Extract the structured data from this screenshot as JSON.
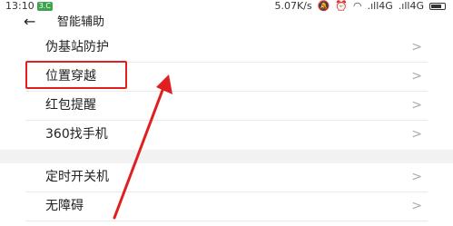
{
  "status_bar": {
    "time": "13:10",
    "badge": "3.C",
    "speed": "5.07K/s",
    "icons": [
      "mute-icon",
      "alarm-icon",
      "wifi-icon",
      "signal-4g-icon",
      "signal-4g-icon",
      "battery-icon"
    ],
    "net1": ".ıll4G",
    "net2": ".ıll4G"
  },
  "header": {
    "title": "智能辅助"
  },
  "settings": {
    "group1": [
      {
        "label": "伪基站防护"
      },
      {
        "label": "位置穿越"
      },
      {
        "label": "红包提醒"
      },
      {
        "label": "360找手机"
      }
    ],
    "group2": [
      {
        "label": "定时开关机"
      },
      {
        "label": "无障碍"
      }
    ],
    "chevron": ">"
  },
  "annotation": {
    "highlight_color": "#e02020",
    "highlighted_item": "位置穿越"
  }
}
